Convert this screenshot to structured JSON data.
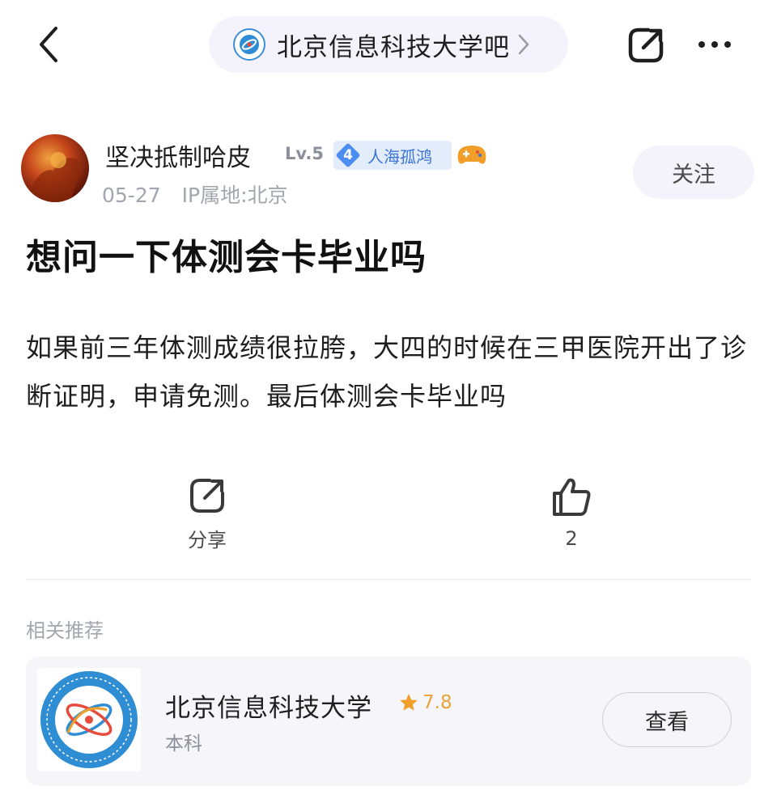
{
  "header": {
    "forum_name": "北京信息科技大学吧",
    "icons": {
      "back": "back-arrow-icon",
      "forum_logo": "university-logo-icon",
      "chevron": "chevron-right-icon",
      "share": "share-icon",
      "more": "more-dots-icon"
    }
  },
  "author": {
    "name": "坚决抵制哈皮",
    "level": "Lv.5",
    "badge_number": "4",
    "badge_title": "人海孤鸿",
    "date": "05-27",
    "ip_location": "IP属地:北京",
    "follow_label": "关注",
    "icons": {
      "avatar": "avatar-image",
      "game": "gamepad-icon"
    }
  },
  "post": {
    "title": "想问一下体测会卡毕业吗",
    "body": "如果前三年体测成绩很拉胯，大四的时候在三甲医院开出了诊断证明，申请免测。最后体测会卡毕业吗"
  },
  "actions": {
    "share_label": "分享",
    "like_count": "2",
    "icons": {
      "share": "share-icon",
      "like": "thumbs-up-icon"
    }
  },
  "related": {
    "title": "相关推荐",
    "card": {
      "name": "北京信息科技大学",
      "rating": "7.8",
      "type": "本科",
      "view_label": "查看",
      "icons": {
        "logo": "university-emblem",
        "star": "star-icon"
      }
    }
  },
  "colors": {
    "pill_bg": "#f4f2fa",
    "badge_bg": "#e2ecfb",
    "badge_text": "#3b73d6",
    "rating": "#e8a33a",
    "muted_text": "#a3a6ad"
  }
}
